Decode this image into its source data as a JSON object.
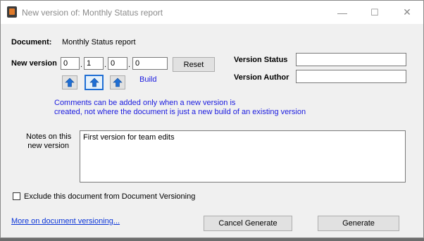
{
  "window": {
    "title": "New version of: Monthly Status report",
    "minimize_glyph": "—",
    "maximize_glyph": "☐",
    "close_glyph": "✕"
  },
  "document": {
    "label": "Document:",
    "value": "Monthly Status report"
  },
  "new_version": {
    "label": "New version",
    "parts": [
      "0",
      "1",
      "0",
      "0"
    ],
    "separator": ".",
    "reset_label": "Reset",
    "build_label": "Build",
    "arrow_glyph": "⬆"
  },
  "version_status": {
    "label": "Version Status",
    "value": ""
  },
  "version_author": {
    "label": "Version Author",
    "value": ""
  },
  "comment_note": {
    "line1": "Comments can be added only when a new version is",
    "line2": "created, not where the document is just a new build of an existing version"
  },
  "notes": {
    "label_line1": "Notes on this",
    "label_line2": "new version",
    "value": "First version for team edits"
  },
  "exclude": {
    "label": "Exclude this document from Document Versioning",
    "checked": false
  },
  "footer": {
    "link_label": "More on document versioning...",
    "cancel_label": "Cancel Generate",
    "generate_label": "Generate"
  },
  "colors": {
    "note_text": "#1a1adf",
    "link": "#0b35d8",
    "selected_border": "#1f6ed4",
    "arrow": "#1f6ed4"
  }
}
